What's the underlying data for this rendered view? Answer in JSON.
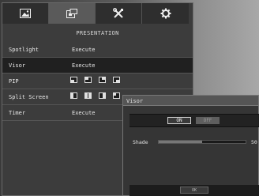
{
  "tabs": [
    {
      "icon": "image-icon",
      "active": false
    },
    {
      "icon": "pip-display-icon",
      "active": true
    },
    {
      "icon": "tools-icon",
      "active": false
    },
    {
      "icon": "gear-icon",
      "active": false
    }
  ],
  "menu": {
    "title": "PRESENTATION",
    "items": [
      {
        "label": "Spotlight",
        "value": "Execute"
      },
      {
        "label": "Visor",
        "value": "Execute"
      },
      {
        "label": "PIP",
        "value": ""
      },
      {
        "label": "Split Screen",
        "value": ""
      },
      {
        "label": "Timer",
        "value": "Execute"
      }
    ],
    "selected_item": "Visor"
  },
  "dialog": {
    "title": "Visor",
    "on_label": "ON",
    "off_label": "OFF",
    "selected_toggle": "ON",
    "shade_label": "Shade",
    "shade_value": "50",
    "shade_fraction": 0.5,
    "ok_label": "OK"
  }
}
